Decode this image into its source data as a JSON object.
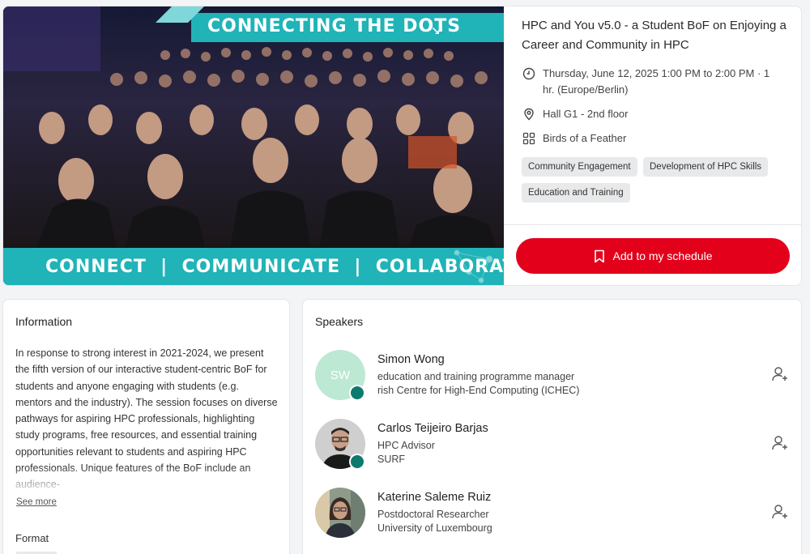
{
  "banner": {
    "top_text": "CONNECTING THE DOTS",
    "top_arrow": "↘",
    "bottom_text": "CONNECT  |  COMMUNICATE  |  COLLABORATE",
    "accent_color": "#20b3b8"
  },
  "event": {
    "title": "HPC and You v5.0 - a Student BoF on Enjoying a Career and Community in HPC",
    "datetime": "Thursday, June 12, 2025 1:00 PM to 2:00 PM · 1 hr. (Europe/Berlin)",
    "location": "Hall G1 - 2nd floor",
    "session_type": "Birds of a Feather",
    "tags": [
      "Community Engagement",
      "Development of HPC Skills",
      "Education and Training"
    ],
    "schedule_button": "Add to my schedule",
    "brand_color": "#e3001b"
  },
  "information": {
    "title": "Information",
    "description": "In response to strong interest in 2021-2024, we present the fifth version of our interactive student-centric BoF for students and anyone engaging with students (e.g. mentors and the industry). The session focuses on diverse pathways for aspiring HPC professionals, highlighting study programs, free resources, and essential training opportunities relevant to students and aspiring HPC professionals. Unique features of the BoF include an audience-",
    "see_more": "See more",
    "format_title": "Format"
  },
  "speakers": {
    "title": "Speakers",
    "items": [
      {
        "initials": "SW",
        "name": "Simon Wong",
        "role": "education and training programme manager",
        "org": "rish Centre for High-End Computing (ICHEC)",
        "online": true
      },
      {
        "initials": "",
        "name": "Carlos Teijeiro Barjas",
        "role": "HPC Advisor",
        "org": "SURF",
        "online": true
      },
      {
        "initials": "",
        "name": "Katerine Saleme Ruiz",
        "role": "Postdoctoral Researcher",
        "org": "University of Luxembourg",
        "online": false
      }
    ]
  }
}
